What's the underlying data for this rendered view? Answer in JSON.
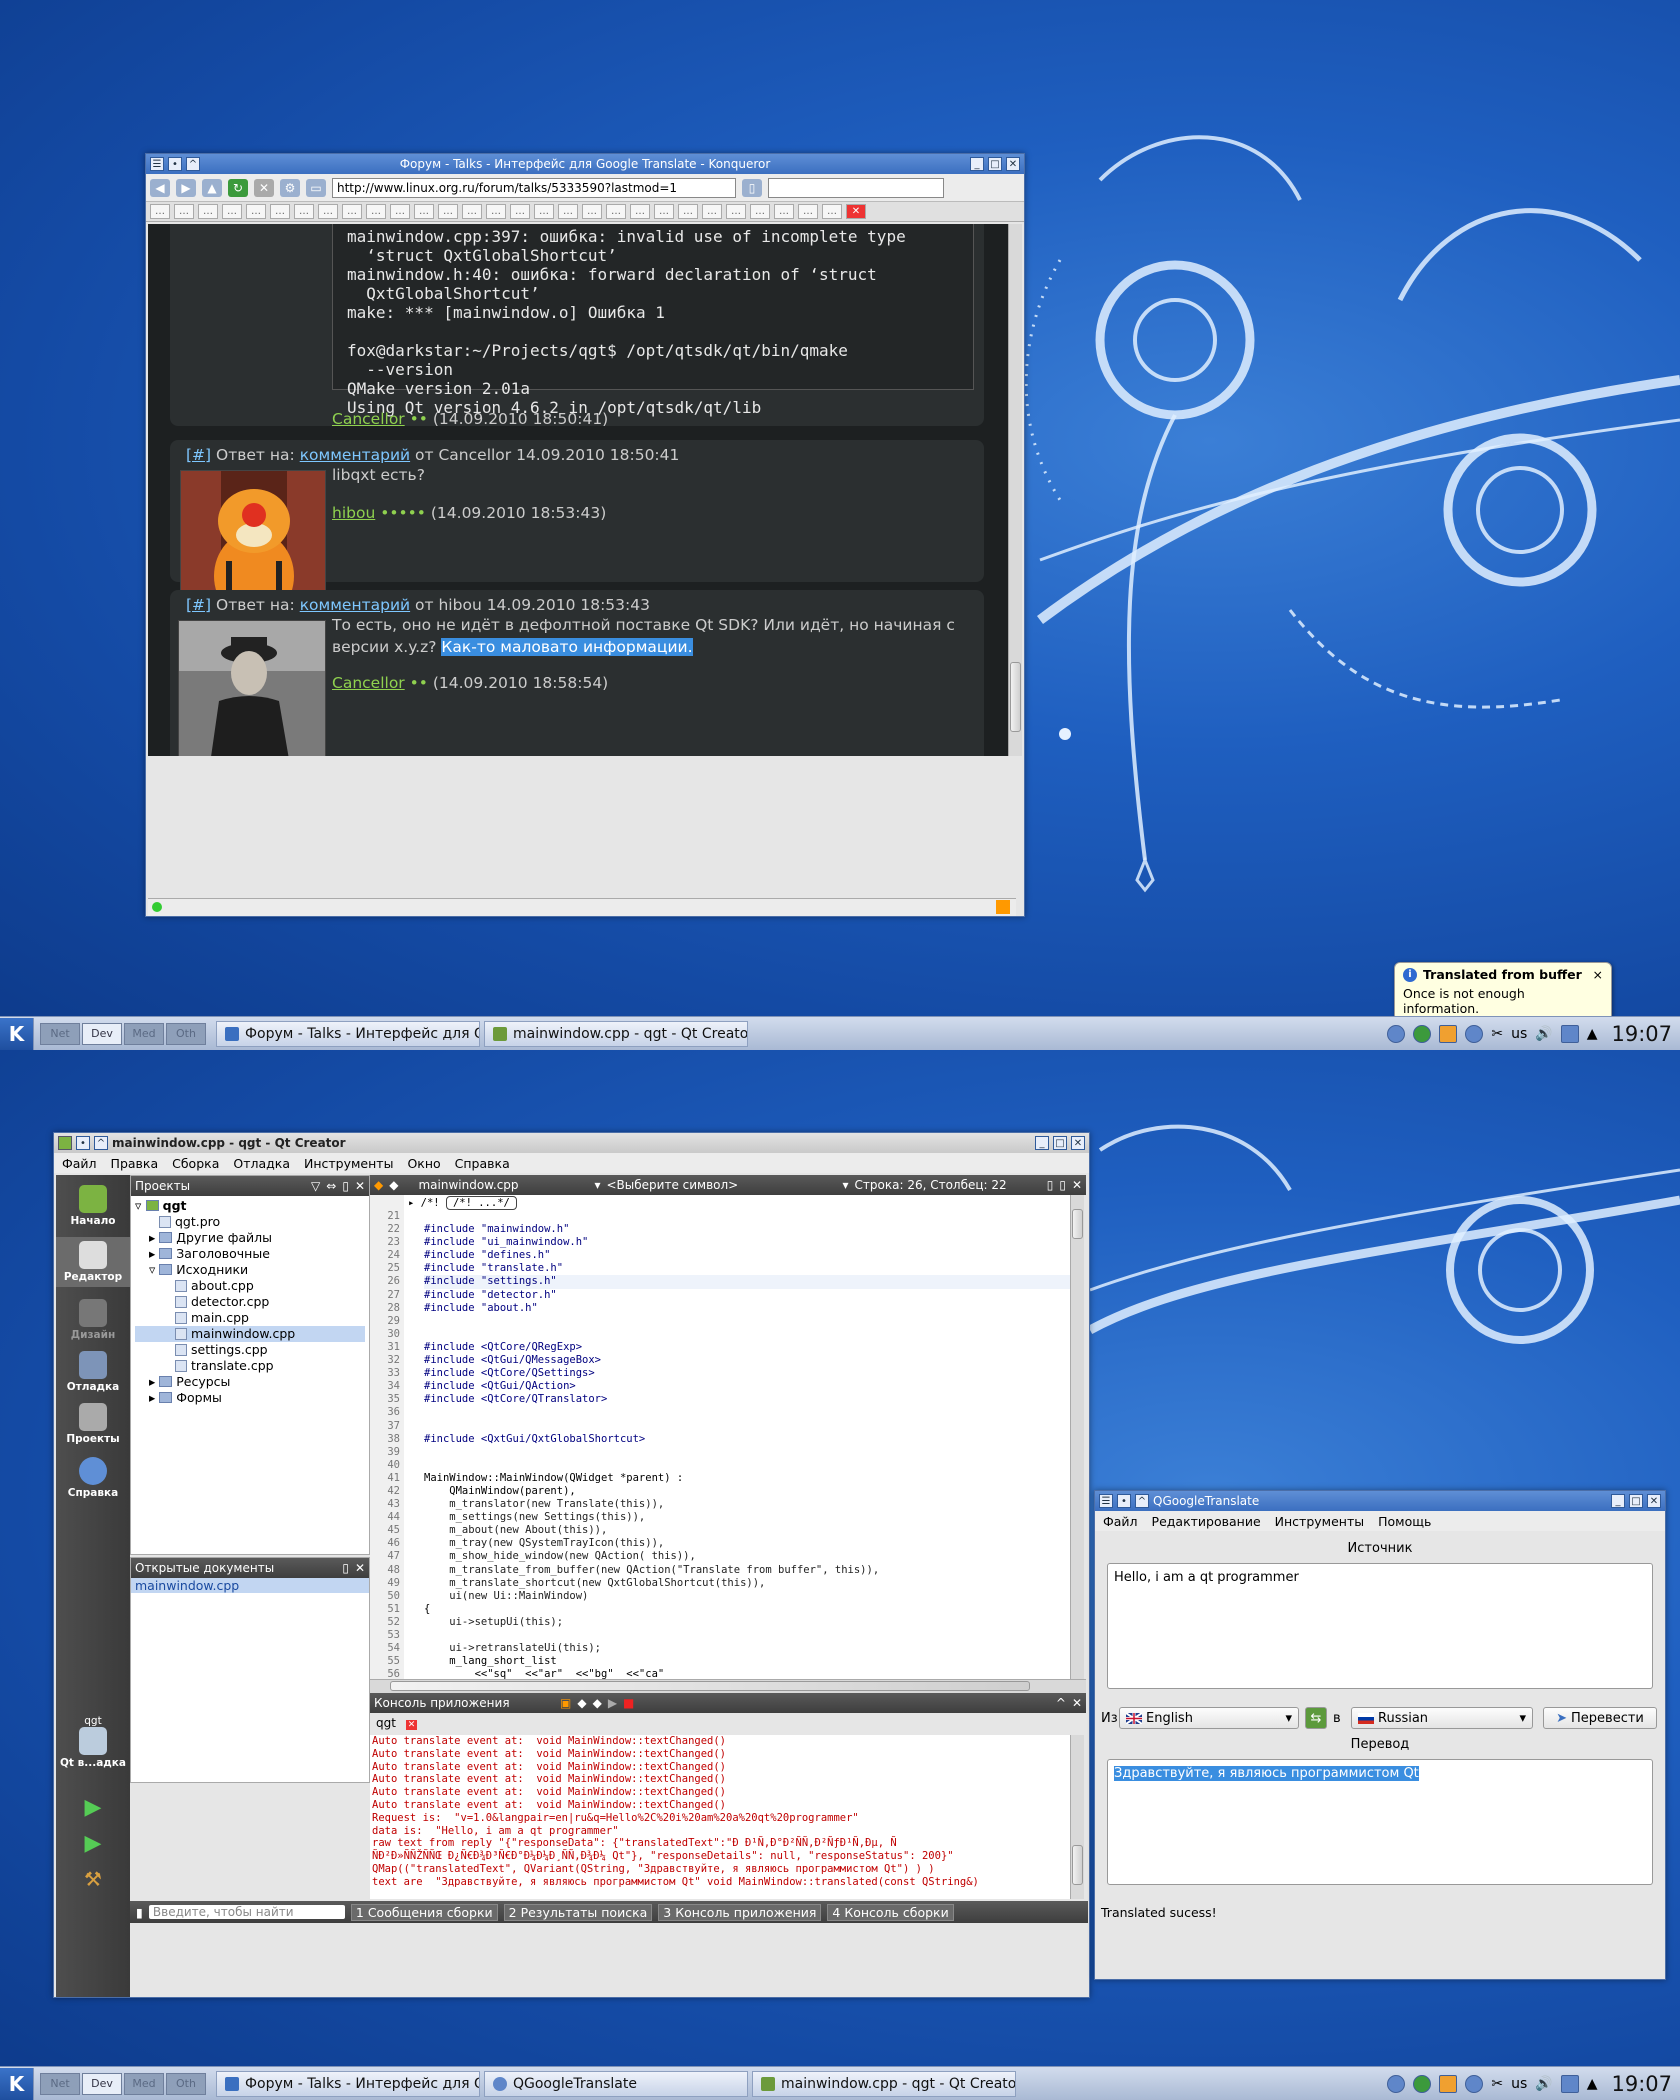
{
  "top": {
    "konqueror": {
      "title": "Форум - Talks - Интерфейс для Google Translate - Konqueror",
      "url": "http://www.linux.org.ru/forum/talks/5333590?lastmod=1",
      "post1": {
        "code_lines": [
          "mainwindow.cpp:397: ошибка: invalid use of incomplete type",
          "  ‘struct QxtGlobalShortcut’",
          "mainwindow.h:40: ошибка: forward declaration of ‘struct",
          "  QxtGlobalShortcut’",
          "make: *** [mainwindow.o] Ошибка 1",
          "",
          "fox@darkstar:~/Projects/qgt$ /opt/qtsdk/qt/bin/qmake",
          "  --version",
          "QMake version 2.01a",
          "Using Qt version 4.6.2 in /opt/qtsdk/qt/lib"
        ],
        "author": "Cancellor",
        "dots": "••",
        "time": "(14.09.2010 18:50:41)"
      },
      "post2": {
        "hash": "[#]",
        "reply_prefix": "Ответ на:",
        "reply_link": "комментарий",
        "reply_suffix": "от Cancellor 14.09.2010 18:50:41",
        "text": "libqxt есть?",
        "author": "hibou",
        "dots": "•••••",
        "time": "(14.09.2010 18:53:43)"
      },
      "post3": {
        "hash": "[#]",
        "reply_prefix": "Ответ на:",
        "reply_link": "комментарий",
        "reply_suffix": "от hibou 14.09.2010 18:53:43",
        "text1": "То есть, оно не идёт в дефолтной поставке Qt SDK? Или идёт, но начиная с",
        "text2": "версии x.y.z?",
        "selected": "Как-то маловато информации.",
        "author": "Cancellor",
        "dots": "••",
        "time": "(14.09.2010 18:58:54)"
      }
    },
    "tooltip": {
      "title": "Translated from buffer",
      "body": "Once is not enough information."
    },
    "taskbar": {
      "pager": [
        "Net",
        "Dev",
        "Med",
        "Oth"
      ],
      "tasks": [
        "Форум - Talks - Интерфейс для Goog",
        "mainwindow.cpp - qgt - Qt Creator"
      ],
      "layout": "us",
      "clock": "19:07"
    }
  },
  "bottom": {
    "creator": {
      "title": "mainwindow.cpp - qgt - Qt Creator",
      "menu": [
        "Файл",
        "Правка",
        "Сборка",
        "Отладка",
        "Инструменты",
        "Окно",
        "Справка"
      ],
      "projects_label": "Проекты",
      "tree": [
        "qgt",
        "qgt.pro",
        "Другие файлы",
        "Заголовочные",
        "Исходники",
        "about.cpp",
        "detector.cpp",
        "main.cpp",
        "mainwindow.cpp",
        "settings.cpp",
        "translate.cpp",
        "Ресурсы",
        "Формы"
      ],
      "open_docs_label": "Открытые документы",
      "open_doc": "mainwindow.cpp",
      "file_combo": "mainwindow.cpp",
      "symbol_combo": "<Выберите символ>",
      "position": "Строка: 26, Столбец: 22",
      "modes": [
        "Начало",
        "Редактор",
        "Дизайн",
        "Отладка",
        "Проекты",
        "Справка"
      ],
      "target_project": "qgt",
      "target_label": "Qt в...адка",
      "code_first_line": "/*!  ...*/",
      "line_numbers": [
        "21",
        "22",
        "23",
        "24",
        "25",
        "26",
        "27",
        "28",
        "29",
        "30",
        "31",
        "32",
        "33",
        "34",
        "35",
        "36",
        "37",
        "38",
        "39",
        "40",
        "41",
        "42",
        "43",
        "44",
        "45",
        "46",
        "47",
        "48",
        "49",
        "50",
        "51",
        "52",
        "53",
        "54",
        "55",
        "56"
      ],
      "code": [
        "",
        "#include \"mainwindow.h\"",
        "#include \"ui_mainwindow.h\"",
        "#include \"defines.h\"",
        "#include \"translate.h\"",
        "#include \"settings.h\"",
        "#include \"detector.h\"",
        "#include \"about.h\"",
        "",
        "",
        "#include <QtCore/QRegExp>",
        "#include <QtGui/QMessageBox>",
        "#include <QtCore/QSettings>",
        "#include <QtGui/QAction>",
        "#include <QtCore/QTranslator>",
        "",
        "",
        "#include <QxtGui/QxtGlobalShortcut>",
        "",
        "",
        "MainWindow::MainWindow(QWidget *parent) :",
        "    QMainWindow(parent),",
        "    m_translator(new Translate(this)),",
        "    m_settings(new Settings(this)),",
        "    m_about(new About(this)),",
        "    m_tray(new QSystemTrayIcon(this)),",
        "    m_show_hide_window(new QAction( this)),",
        "    m_translate_from_buffer(new QAction(\"Translate from buffer\", this)),",
        "    m_translate_shortcut(new QxtGlobalShortcut(this)),",
        "    ui(new Ui::MainWindow)",
        "{",
        "    ui->setupUi(this);",
        "",
        "    ui->retranslateUi(this);",
        "    m_lang_short_list",
        "        <<\"sq\"  <<\"ar\"  <<\"bg\"  <<\"ca\""
      ],
      "console_label": "Консоль приложения",
      "console_tab": "qgt",
      "console": [
        "Auto translate event at:  void MainWindow::textChanged()",
        "Auto translate event at:  void MainWindow::textChanged()",
        "Auto translate event at:  void MainWindow::textChanged()",
        "Auto translate event at:  void MainWindow::textChanged()",
        "Auto translate event at:  void MainWindow::textChanged()",
        "Auto translate event at:  void MainWindow::textChanged()",
        "Request is:  \"v=1.0&langpair=en|ru&q=Hello%2C%20i%20am%20a%20qt%20programmer\"",
        "data is:  \"Hello, i am a qt programmer\"",
        "raw text from reply \"{\"responseData\": {\"translatedText\":\"Ð Ð¹Ñ‚Ð°Ð²ÑÑ‚Ð²ÑƒÐ¹Ñ‚Ðµ, Ñ",
        "ÑÐ²Ð»ÑÑŽÑÑŒ Ð¿Ñ€Ð¾Ð³Ñ€Ð°Ð¼Ð¼Ð¸ÑÑ‚Ð¾Ð¼ Qt\"}, \"responseDetails\": null, \"responseStatus\": 200}\"",
        "QMap((\"translatedText\", QVariant(QString, \"Здравствуйте, я являюсь программистом Qt\") ) )",
        "text are  \"Здравствуйте, я являюсь программистом Qt\" void MainWindow::translated(const QString&)"
      ],
      "search_placeholder": "Введите, чтобы найти",
      "output_tabs": [
        "1 Сообщения сборки",
        "2 Результаты поиска",
        "3 Консоль приложения",
        "4 Консоль сборки"
      ]
    },
    "qgt": {
      "title": "QGoogleTranslate",
      "menu": [
        "Файл",
        "Редактирование",
        "Инструменты",
        "Помощь"
      ],
      "source_label": "Источник",
      "source_text": "Hello, i am a qt programmer",
      "from_label": "Из",
      "from_lang": "English",
      "to_label": "в",
      "to_lang": "Russian",
      "translate_btn": "Перевести",
      "result_label": "Перевод",
      "result_text": "Здравствуйте, я являюсь программистом Qt",
      "status": "Translated sucess!"
    },
    "taskbar": {
      "pager": [
        "Net",
        "Dev",
        "Med",
        "Oth"
      ],
      "tasks": [
        "Форум - Talks - Интерфейс для Goog",
        "QGoogleTranslate",
        "mainwindow.cpp - qgt - Qt Creator"
      ],
      "layout": "us",
      "clock": "19:07"
    }
  }
}
